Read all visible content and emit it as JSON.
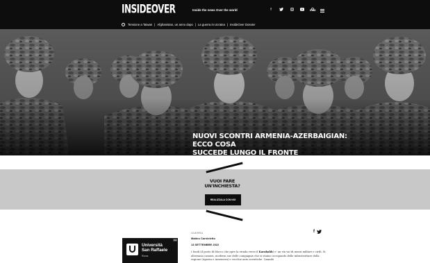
{
  "header": {
    "logo_text": "INSIDEOVER",
    "tagline": "Inside the news Over the world",
    "social_icons": [
      "facebook-icon",
      "twitter-icon",
      "instagram-icon",
      "youtube-icon"
    ],
    "lang": "ENG"
  },
  "subnav": {
    "items": [
      {
        "label": "Tensione a Taiwan"
      },
      {
        "label": "Afghanistan, un anno dopo"
      },
      {
        "label": "La guerra in Ucraina"
      },
      {
        "label": "InsideOver Dossier"
      }
    ]
  },
  "hero": {
    "title_line1": "Nuovi scontri Armenia-Azerbaigian: ecco cosa",
    "title_line2": "succede lungo il fronte"
  },
  "promo": {
    "title_line1": "Vuoi fare",
    "title_line2": "un'inchiesta?",
    "button_label": "REALIZZALA CON NOI"
  },
  "ad": {
    "tag": "Ad",
    "line1": "Università",
    "line2": "San Raffaele",
    "line3": "Roma"
  },
  "article": {
    "category": "GUERRA",
    "share_icons": [
      "facebook-icon",
      "twitter-icon"
    ],
    "author": "Matteo Carnieletto",
    "date": "13 SETTEMBRE 2022",
    "body_pre": "I fondi (il posto di blocco che apre la strada verso il ",
    "body_bold": "Karabakh",
    "body_post": ") e' un via vai di mezzi militari e civili. Si alternano camion, moderni suv delle compagnie che si stanno occupando delle infrastrutture della regione (Agsera e Azsemera) e vecchie auto sovietiche. Quando"
  },
  "colors": {
    "header_bg": "#0d0d0d",
    "promo_bg": "#c8c8c8"
  }
}
